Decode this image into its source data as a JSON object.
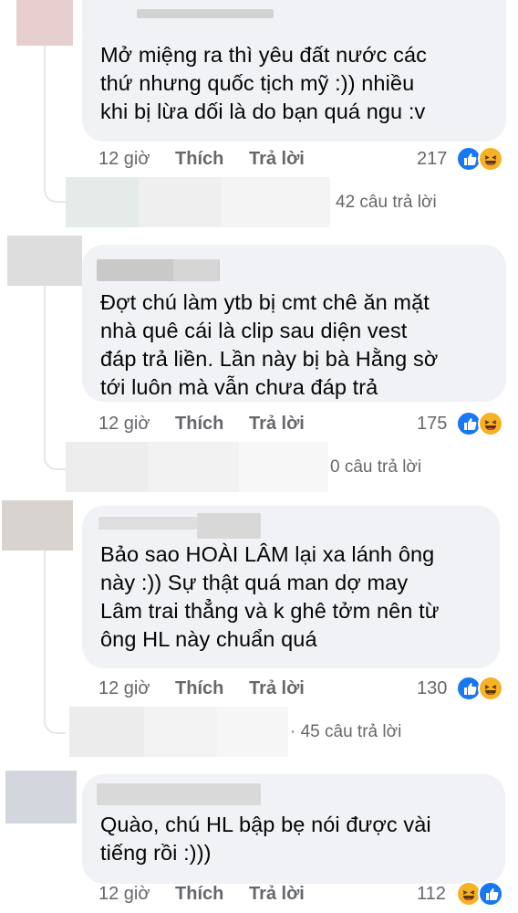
{
  "actions": {
    "like": "Thích",
    "reply": "Trả lời"
  },
  "comments": [
    {
      "text": "Mở miệng ra thì yêu đất nước các\nthứ nhưng quốc tịch mỹ :)) nhiều\nkhi bị lừa dối là do bạn quá ngu :v",
      "time": "12 giờ",
      "reactions_count": "217",
      "reactions": [
        "like-icon",
        "haha-icon"
      ],
      "replies": "42 câu trả lời"
    },
    {
      "text": "Đợt chú làm ytb bị cmt chê ăn mặt\nnhà quê cái là clip sau diện vest\nđáp trả liền. Lần này bị bà Hằng sờ\ntới luôn mà vẫn chưa đáp trả",
      "time": "12 giờ",
      "reactions_count": "175",
      "reactions": [
        "like-icon",
        "haha-icon"
      ],
      "replies": "0 câu trả lời"
    },
    {
      "text": "Bảo sao HOÀI LÂM lại xa lánh ông\nnày :)) Sự thật quá man dợ may\nLâm trai thẳng và k ghê tởm nên từ\nông HL này chuẩn quá",
      "time": "12 giờ",
      "reactions_count": "130",
      "reactions": [
        "like-icon",
        "haha-icon"
      ],
      "replies": "· 45 câu trả lời"
    },
    {
      "text": "Quào, chú HL bập bẹ nói được vài\ntiếng rồi :)))",
      "time": "12 giờ",
      "reactions_count": "112",
      "reactions": [
        "haha-icon",
        "like-icon"
      ]
    }
  ],
  "colors": {
    "bubble": "#f0f2f5",
    "meta_text": "#65676b",
    "like_blue": "#1877f2",
    "haha_yellow": "#f7b125",
    "thread_line": "#e4e6eb"
  }
}
